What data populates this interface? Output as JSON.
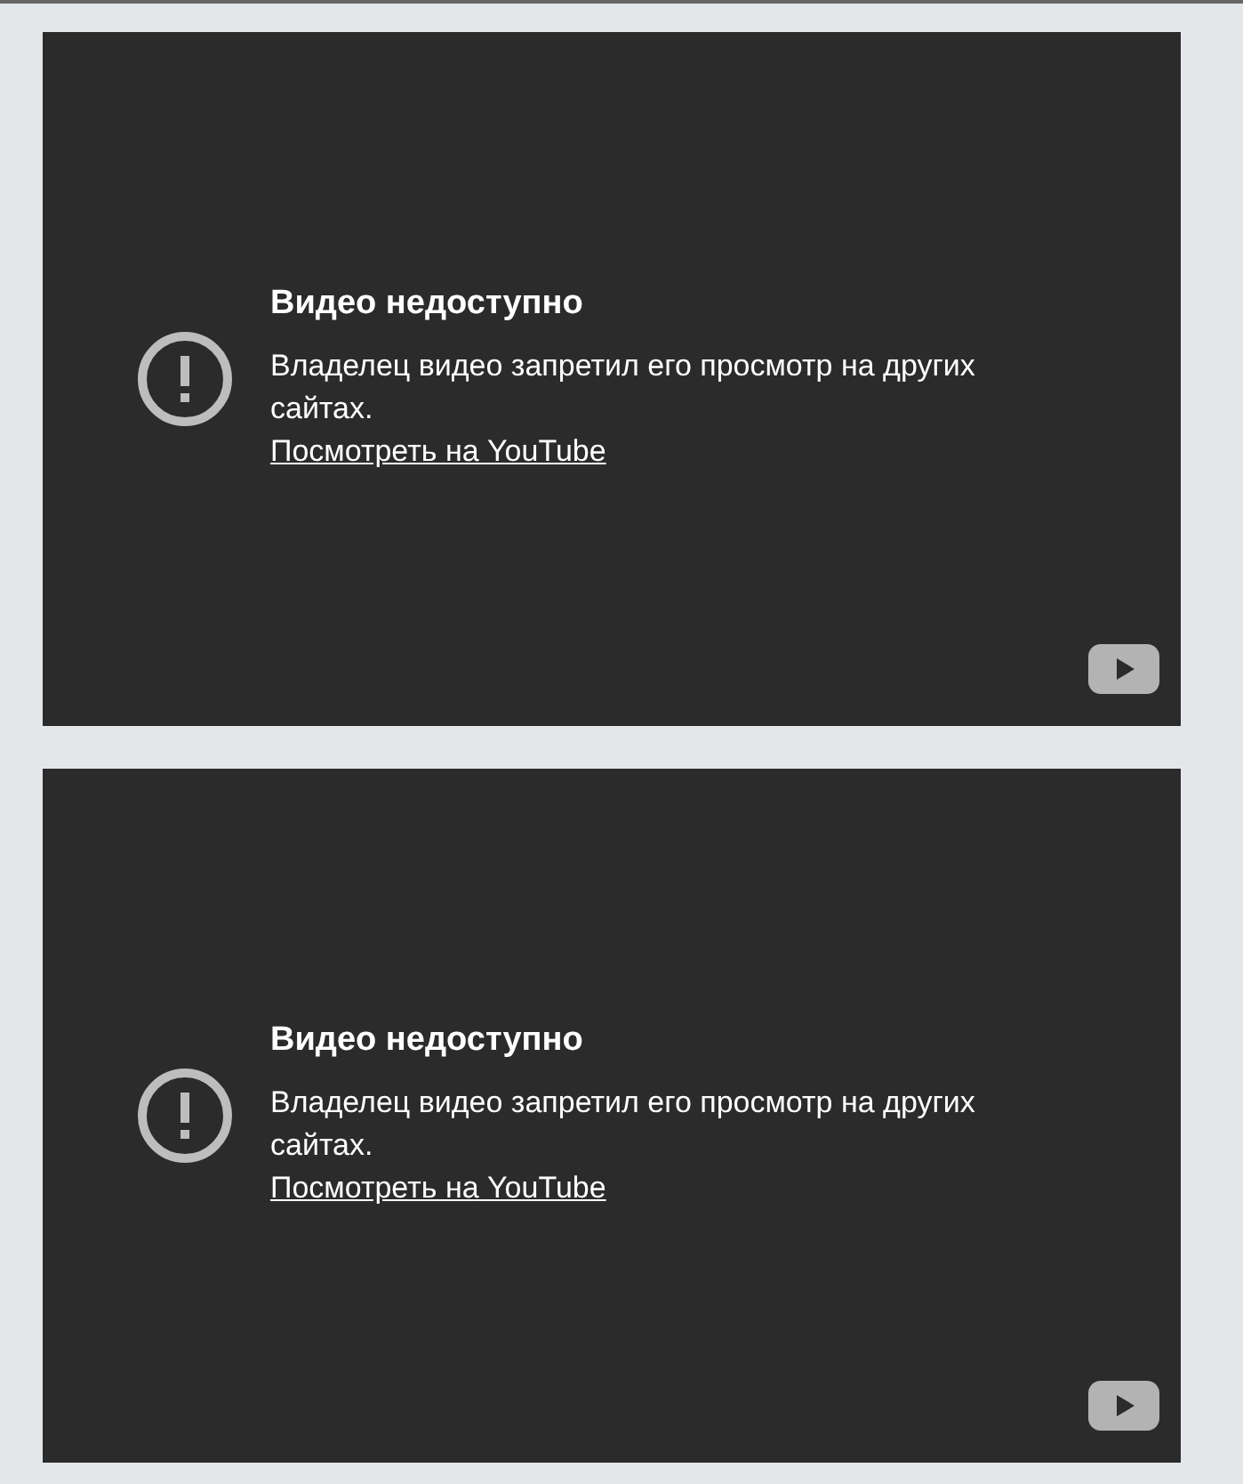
{
  "players": [
    {
      "title": "Видео недоступно",
      "message": "Владелец видео запретил его просмотр на других сайтах.",
      "link": "Посмотреть на YouTube"
    },
    {
      "title": "Видео недоступно",
      "message": "Владелец видео запретил его просмотр на других сайтах.",
      "link": "Посмотреть на YouTube"
    }
  ]
}
